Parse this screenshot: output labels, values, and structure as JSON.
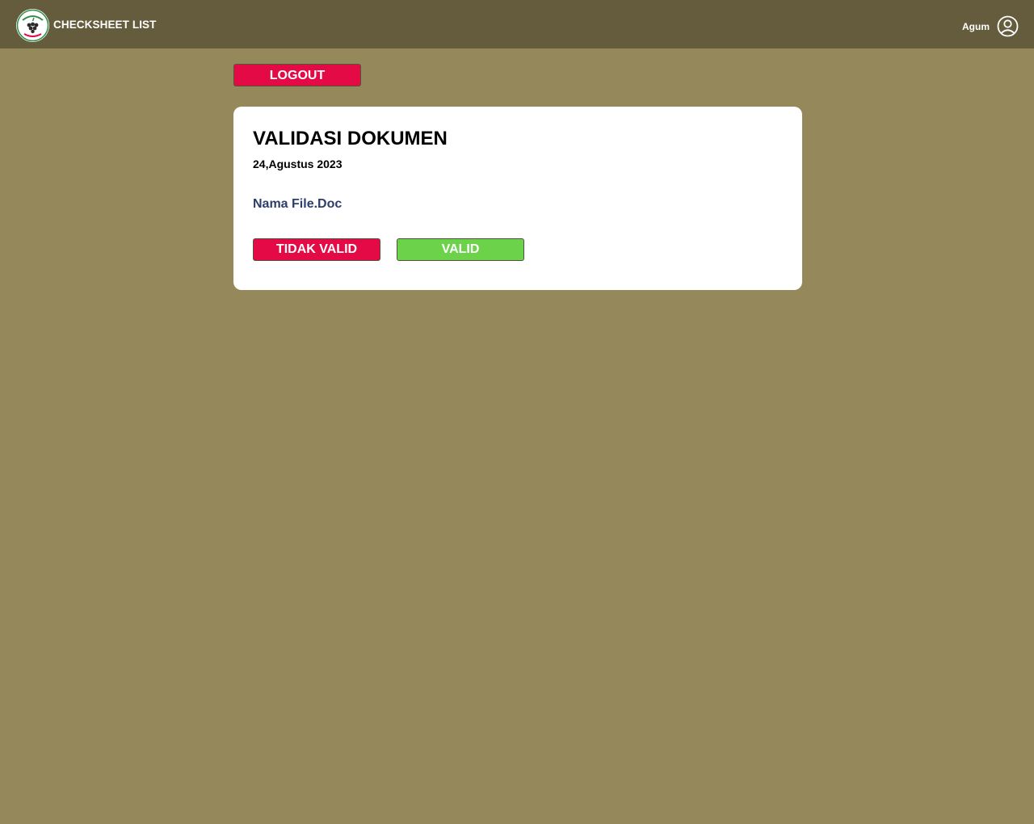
{
  "header": {
    "title": "CHECKSHEET LIST",
    "user_name": "Agum",
    "logo_text_top": "ROP TUR",
    "logo_text_bottom": "ANGGUR"
  },
  "actions": {
    "logout_label": "LOGOUT"
  },
  "card": {
    "title": "VALIDASI DOKUMEN",
    "date": "24,Agustus 2023",
    "file_name": "Nama File.Doc",
    "invalid_label": "TIDAK VALID",
    "valid_label": "VALID"
  },
  "colors": {
    "header_bg": "#655c3d",
    "page_bg": "#95885b",
    "danger": "#e30a45",
    "success": "#6cd24a",
    "file_link": "#2d3e6b"
  },
  "icons": {
    "user": "user-circle-icon",
    "logo": "grape-logo-icon"
  }
}
